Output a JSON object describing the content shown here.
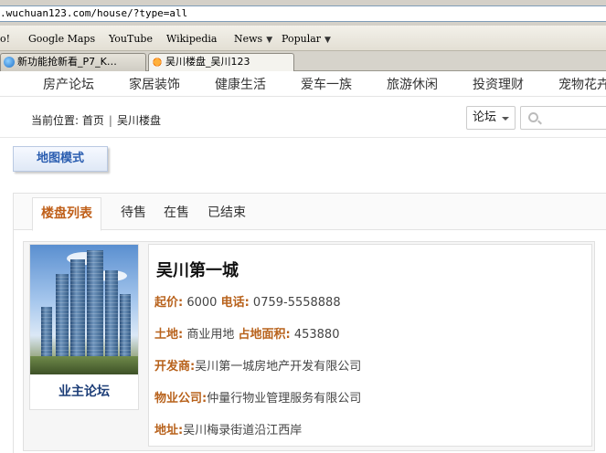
{
  "browser": {
    "url": ".wuchuan123.com/house/?type=all",
    "bookmarks": [
      {
        "label": "o!"
      },
      {
        "label": "Google Maps"
      },
      {
        "label": "YouTube"
      },
      {
        "label": "Wikipedia"
      },
      {
        "label": "News",
        "dropdown": true
      },
      {
        "label": "Popular",
        "dropdown": true
      }
    ],
    "tabs": [
      {
        "label": "新功能抢新看_P7_K…",
        "active": false,
        "icon": "globe-icon"
      },
      {
        "label": "吴川楼盘_吴川123",
        "active": true,
        "icon": "sun-logo-icon"
      }
    ]
  },
  "nav": {
    "items": [
      "房产论坛",
      "家居装饰",
      "健康生活",
      "爱车一族",
      "旅游休闲",
      "投资理财",
      "宠物花卉"
    ]
  },
  "breadcrumb": {
    "prefix": "当前位置:",
    "home": "首页",
    "separator": "|",
    "current": "吴川楼盘"
  },
  "search": {
    "scope_label": "论坛",
    "placeholder": ""
  },
  "map_mode_label": "地图模式",
  "listing_tabs": [
    {
      "label": "楼盘列表",
      "active": true
    },
    {
      "label": "待售",
      "active": false
    },
    {
      "label": "在售",
      "active": false
    },
    {
      "label": "已结束",
      "active": false
    }
  ],
  "estate": {
    "owner_forum_label": "业主论坛",
    "name": "吴川第一城",
    "price_label": "起价:",
    "price_value": "6000",
    "phone_label": "电话:",
    "phone_value": "0759-5558888",
    "land_label": "土地:",
    "land_value": "商业用地",
    "area_label": "占地面积:",
    "area_value": "453880",
    "developer_label": "开发商:",
    "developer_value": "吴川第一城房地产开发有限公司",
    "property_mgmt_label": "物业公司:",
    "property_mgmt_value": "仲量行物业管理服务有限公司",
    "address_label": "地址:",
    "address_value": "吴川梅录街道沿江西岸"
  },
  "colors": {
    "accent_orange": "#b8621c",
    "link_blue": "#2a5db0",
    "forum_blue": "#1d3e78"
  }
}
